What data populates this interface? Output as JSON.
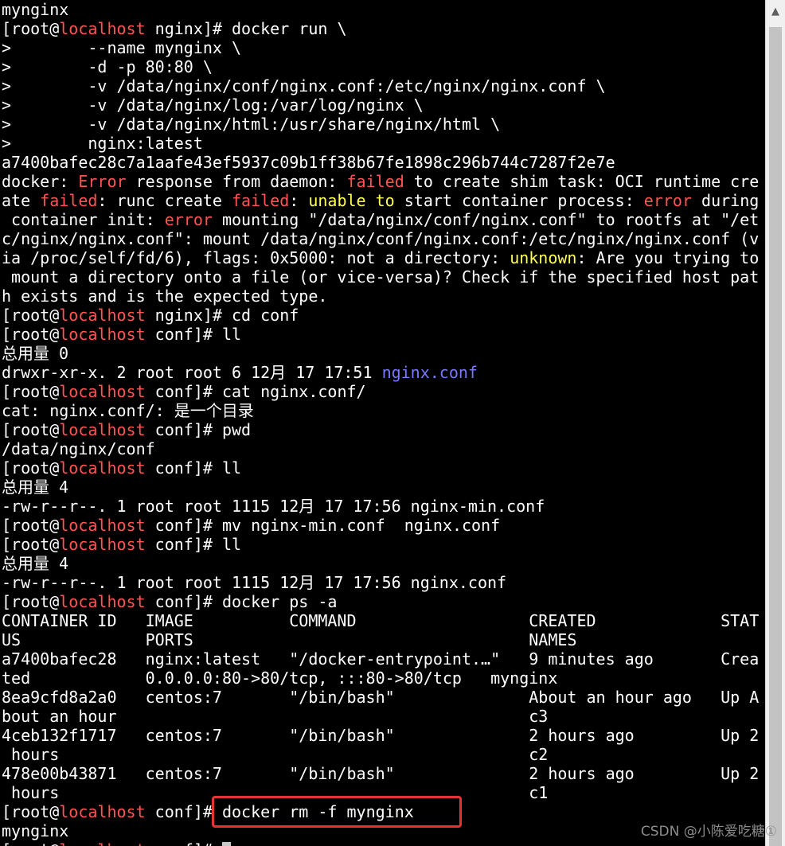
{
  "colors": {
    "background": "#000000",
    "foreground": "#ffffff",
    "hostname": "#ff5454",
    "error": "#ff5454",
    "warning": "#ffff54",
    "directory": "#7878ff",
    "highlight_box": "#e63232"
  },
  "terminal": {
    "lines": [
      [
        {
          "t": "mynginx"
        }
      ],
      [
        {
          "t": "[root@"
        },
        {
          "t": "localhost",
          "c": "red"
        },
        {
          "t": " nginx]# docker run \\"
        }
      ],
      [
        {
          "t": ">        --name mynginx \\"
        }
      ],
      [
        {
          "t": ">        -d -p 80:80 \\"
        }
      ],
      [
        {
          "t": ">        -v /data/nginx/conf/nginx.conf:/etc/nginx/nginx.conf \\"
        }
      ],
      [
        {
          "t": ">        -v /data/nginx/log:/var/log/nginx \\"
        }
      ],
      [
        {
          "t": ">        -v /data/nginx/html:/usr/share/nginx/html \\"
        }
      ],
      [
        {
          "t": ">        nginx:latest"
        }
      ],
      [
        {
          "t": "a7400bafec28c7a1aafe43ef5937c09b1ff38b67fe1898c296b744c7287f2e7e"
        }
      ],
      [
        {
          "t": "docker: "
        },
        {
          "t": "Error",
          "c": "red"
        },
        {
          "t": " response from daemon: "
        },
        {
          "t": "failed",
          "c": "red"
        },
        {
          "t": " to create shim task: OCI runtime cre"
        }
      ],
      [
        {
          "t": "ate "
        },
        {
          "t": "failed",
          "c": "red"
        },
        {
          "t": ": runc create "
        },
        {
          "t": "failed",
          "c": "red"
        },
        {
          "t": ": "
        },
        {
          "t": "unable to",
          "c": "yellow"
        },
        {
          "t": " start container process: "
        },
        {
          "t": "error",
          "c": "red"
        },
        {
          "t": " during"
        }
      ],
      [
        {
          "t": " container init: "
        },
        {
          "t": "error",
          "c": "red"
        },
        {
          "t": " mounting \"/data/nginx/conf/nginx.conf\" to rootfs at \"/et"
        }
      ],
      [
        {
          "t": "c/nginx/nginx.conf\": mount /data/nginx/conf/nginx.conf:/etc/nginx/nginx.conf (v"
        }
      ],
      [
        {
          "t": "ia /proc/self/fd/6), flags: 0x5000: not a directory: "
        },
        {
          "t": "unknown",
          "c": "yellow"
        },
        {
          "t": ": Are you trying to"
        }
      ],
      [
        {
          "t": " mount a directory onto a file (or vice-versa)? Check if the specified host pat"
        }
      ],
      [
        {
          "t": "h exists and is the expected type."
        }
      ],
      [
        {
          "t": "[root@"
        },
        {
          "t": "localhost",
          "c": "red"
        },
        {
          "t": " nginx]# cd conf"
        }
      ],
      [
        {
          "t": "[root@"
        },
        {
          "t": "localhost",
          "c": "red"
        },
        {
          "t": " conf]# ll"
        }
      ],
      [
        {
          "t": "总用量 0"
        }
      ],
      [
        {
          "t": "drwxr-xr-x. 2 root root 6 12月 17 17:51 "
        },
        {
          "t": "nginx.conf",
          "c": "blue"
        }
      ],
      [
        {
          "t": "[root@"
        },
        {
          "t": "localhost",
          "c": "red"
        },
        {
          "t": " conf]# cat nginx.conf/"
        }
      ],
      [
        {
          "t": "cat: nginx.conf/: 是一个目录"
        }
      ],
      [
        {
          "t": "[root@"
        },
        {
          "t": "localhost",
          "c": "red"
        },
        {
          "t": " conf]# pwd"
        }
      ],
      [
        {
          "t": "/data/nginx/conf"
        }
      ],
      [
        {
          "t": "[root@"
        },
        {
          "t": "localhost",
          "c": "red"
        },
        {
          "t": " conf]# ll"
        }
      ],
      [
        {
          "t": "总用量 4"
        }
      ],
      [
        {
          "t": "-rw-r--r--. 1 root root 1115 12月 17 17:56 nginx-min.conf"
        }
      ],
      [
        {
          "t": "[root@"
        },
        {
          "t": "localhost",
          "c": "red"
        },
        {
          "t": " conf]# mv nginx-min.conf  nginx.conf"
        }
      ],
      [
        {
          "t": "[root@"
        },
        {
          "t": "localhost",
          "c": "red"
        },
        {
          "t": " conf]# ll"
        }
      ],
      [
        {
          "t": "总用量 4"
        }
      ],
      [
        {
          "t": "-rw-r--r--. 1 root root 1115 12月 17 17:56 nginx.conf"
        }
      ],
      [
        {
          "t": "[root@"
        },
        {
          "t": "localhost",
          "c": "red"
        },
        {
          "t": " conf]# docker ps -a"
        }
      ],
      [
        {
          "t": "CONTAINER ID   IMAGE          COMMAND                  CREATED             STAT"
        }
      ],
      [
        {
          "t": "US             PORTS                                   NAMES"
        }
      ],
      [
        {
          "t": "a7400bafec28   nginx:latest   \"/docker-entrypoint.…\"   9 minutes ago       Crea"
        }
      ],
      [
        {
          "t": "ted            0.0.0.0:80->80/tcp, :::80->80/tcp   mynginx"
        }
      ],
      [
        {
          "t": "8ea9cfd8a2a0   centos:7       \"/bin/bash\"              About an hour ago   Up A"
        }
      ],
      [
        {
          "t": "bout an hour                                           c3"
        }
      ],
      [
        {
          "t": "4ceb132f1717   centos:7       \"/bin/bash\"              2 hours ago         Up 2"
        }
      ],
      [
        {
          "t": " hours                                                 c2"
        }
      ],
      [
        {
          "t": "478e00b43871   centos:7       \"/bin/bash\"              2 hours ago         Up 2"
        }
      ],
      [
        {
          "t": " hours                                                 c1"
        }
      ],
      [
        {
          "t": "[root@"
        },
        {
          "t": "localhost",
          "c": "red"
        },
        {
          "t": " conf]# docker rm -f mynginx"
        }
      ],
      [
        {
          "t": "mynginx"
        }
      ],
      [
        {
          "t": "[root@"
        },
        {
          "t": "localhost",
          "c": "red"
        },
        {
          "t": " conf]# "
        },
        {
          "cursor": true
        }
      ]
    ]
  },
  "scrollbar": {
    "up_arrow_icon": "caret-up-icon"
  },
  "watermark": {
    "text": "CSDN @小陈爱吃糖①"
  }
}
